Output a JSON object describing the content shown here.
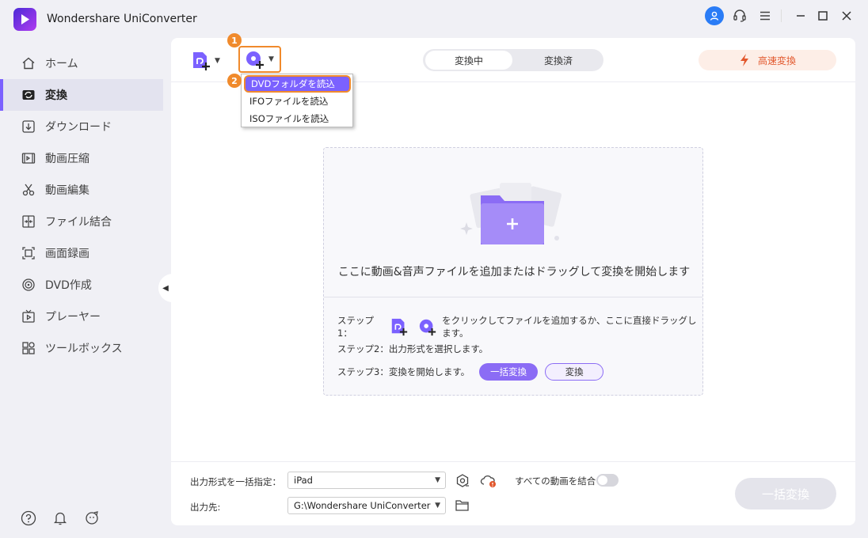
{
  "app": {
    "title": "Wondershare UniConverter"
  },
  "sidebar": {
    "items": [
      {
        "label": "ホーム",
        "icon": "home-icon"
      },
      {
        "label": "変換",
        "icon": "convert-icon",
        "active": true
      },
      {
        "label": "ダウンロード",
        "icon": "download-icon"
      },
      {
        "label": "動画圧縮",
        "icon": "compress-icon"
      },
      {
        "label": "動画編集",
        "icon": "scissors-icon"
      },
      {
        "label": "ファイル結合",
        "icon": "merge-icon"
      },
      {
        "label": "画面録画",
        "icon": "record-icon"
      },
      {
        "label": "DVD作成",
        "icon": "dvd-icon"
      },
      {
        "label": "プレーヤー",
        "icon": "player-icon"
      },
      {
        "label": "ツールボックス",
        "icon": "toolbox-icon"
      }
    ]
  },
  "toolbar": {
    "tabs": {
      "converting": "変換中",
      "converted": "変換済"
    },
    "speed": "高速変換",
    "badge1": "1",
    "badge2": "2"
  },
  "dropdown": {
    "items": [
      "DVDフォルダを読込",
      "IFOファイルを読込",
      "ISOファイルを読込"
    ]
  },
  "dropzone": {
    "main": "ここに動画&音声ファイルを追加またはドラッグして変換を開始します",
    "step1_prefix": "ステップ1：",
    "step1_suffix": "をクリックしてファイルを追加するか、ここに直接ドラッグします。",
    "step2": "ステップ2：出力形式を選択します。",
    "step3": "ステップ3：変換を開始します。",
    "batch_btn": "一括変換",
    "convert_btn": "変換"
  },
  "bottom": {
    "format_label": "出力形式を一括指定：",
    "format_value": "iPad",
    "output_label": "出力先:",
    "output_value": "G:\\Wondershare UniConverter",
    "merge_label": "すべての動画を結合",
    "convert_all": "一括変換"
  },
  "colors": {
    "accent": "#7b61ff",
    "highlight": "#f08a2c",
    "speed": "#e2572c"
  }
}
